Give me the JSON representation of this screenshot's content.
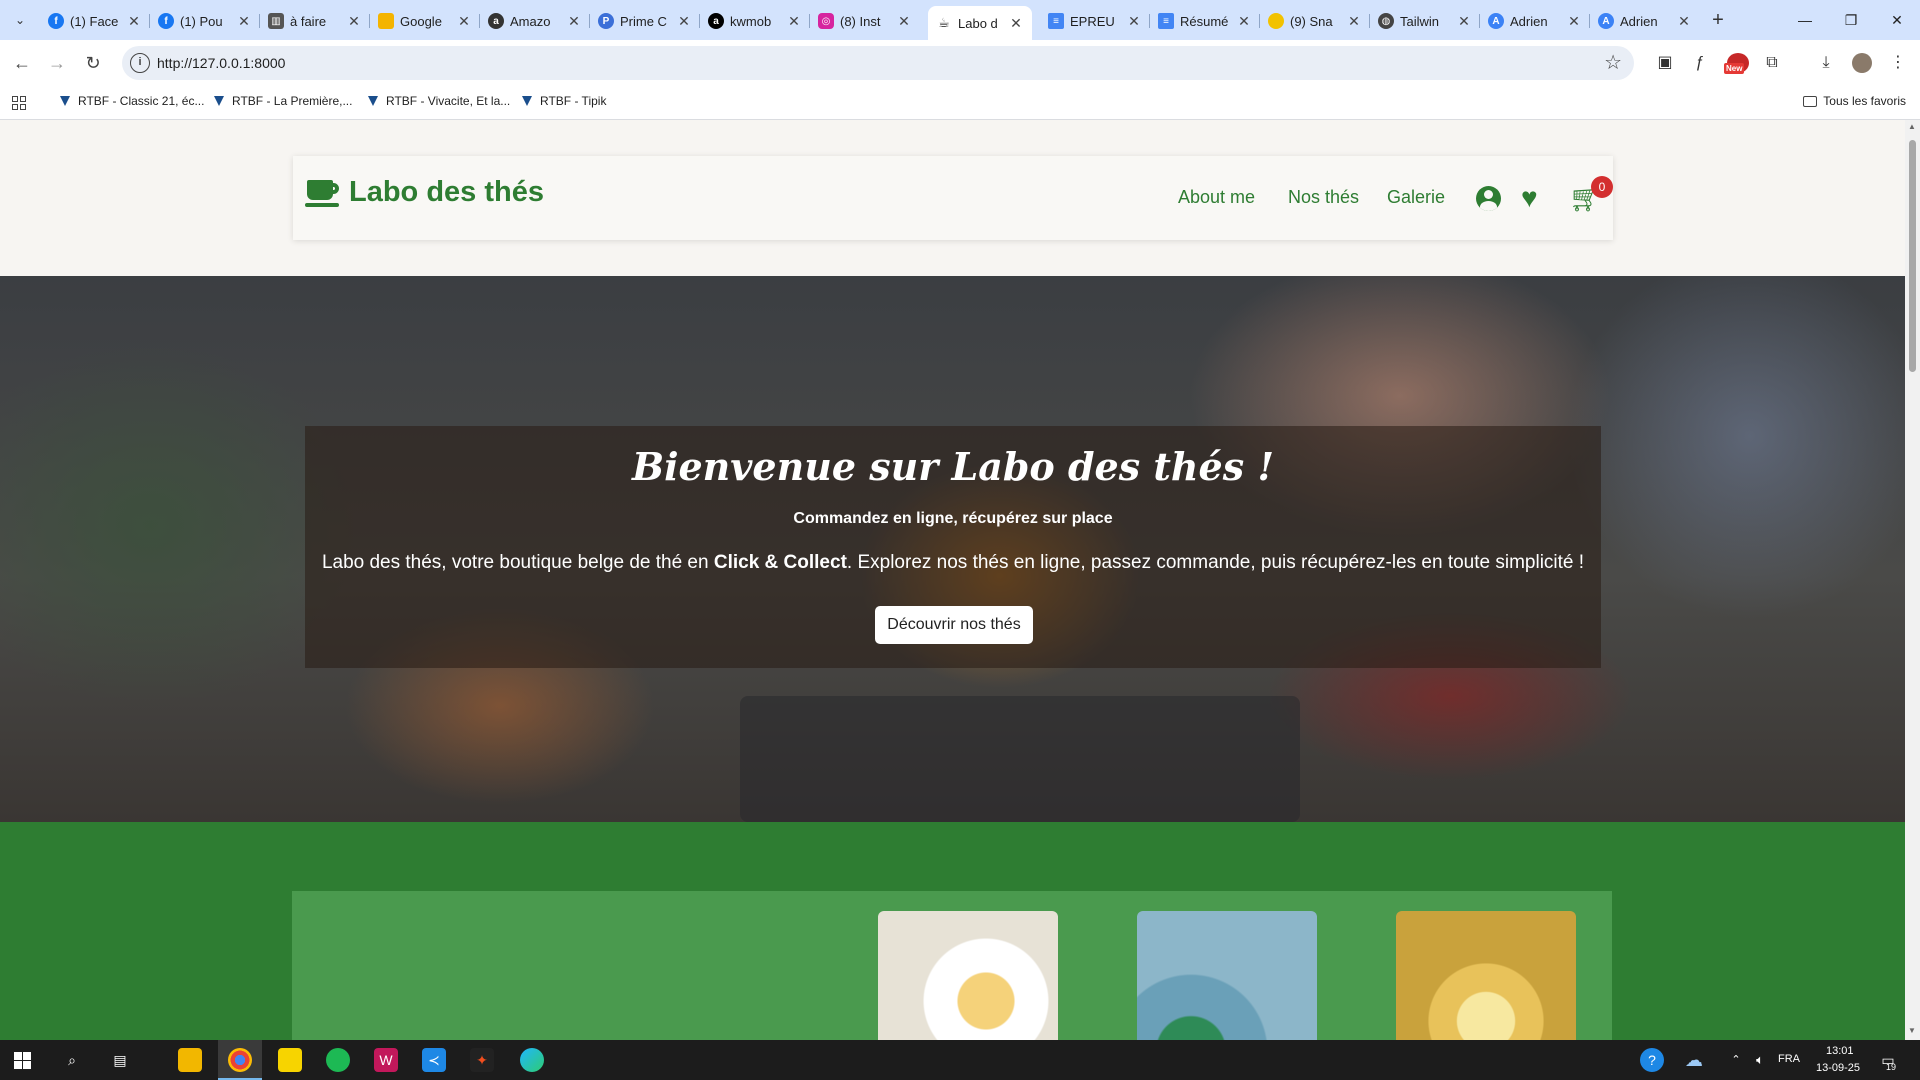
{
  "browser": {
    "tabs": [
      {
        "title": "(1) Face",
        "icon": "facebook-icon",
        "color": "#1877f2"
      },
      {
        "title": "(1) Pou",
        "icon": "facebook-icon",
        "color": "#1877f2"
      },
      {
        "title": "à faire",
        "icon": "trello-icon",
        "color": "#555555"
      },
      {
        "title": "Google",
        "icon": "google-keep-icon",
        "color": "#f4b400"
      },
      {
        "title": "Amazo",
        "icon": "amazon-icon",
        "color": "#333333"
      },
      {
        "title": "Prime C",
        "icon": "prime-icon",
        "color": "#3b6fd8"
      },
      {
        "title": "kwmob",
        "icon": "amazon-icon",
        "color": "#000000"
      },
      {
        "title": "(8) Inst",
        "icon": "instagram-icon",
        "color": "#d6249f"
      },
      {
        "title": "Labo d",
        "icon": "teacup-icon",
        "color": "#222222",
        "active": true
      },
      {
        "title": "EPREU",
        "icon": "docs-icon",
        "color": "#4285f4"
      },
      {
        "title": "Résumé",
        "icon": "docs-icon",
        "color": "#4285f4"
      },
      {
        "title": "(9) Sna",
        "icon": "snapchat-icon",
        "color": "#f2c200"
      },
      {
        "title": "Tailwin",
        "icon": "globe-icon",
        "color": "#444444"
      },
      {
        "title": "Adrien",
        "icon": "profile-icon",
        "color": "#3b82f6"
      },
      {
        "title": "Adrien",
        "icon": "profile-icon",
        "color": "#3b82f6"
      }
    ],
    "url": "http://127.0.0.1:8000",
    "bookmarks": [
      "RTBF - Classic 21, éc...",
      "RTBF - La Première,...",
      "RTBF - Vivacite, Et la...",
      "RTBF - Tipik"
    ],
    "all_favorites": "Tous les favoris",
    "new_badge": "New"
  },
  "site": {
    "brand": "Labo des thés",
    "nav": [
      "About me",
      "Nos thés",
      "Galerie"
    ],
    "cart_count": "0",
    "hero": {
      "title": "Bienvenue sur Labo des thés !",
      "subtitle": "Commandez en ligne, récupérez sur place",
      "text_before": "Labo des thés, votre boutique belge de thé en ",
      "text_bold": "Click & Collect",
      "text_after": ". Explorez nos thés en ligne, passez commande, puis récupérez-les en toute simplicité !",
      "button": "Découvrir nos thés"
    }
  },
  "taskbar": {
    "language": "FRA",
    "time": "13:01",
    "date": "13-09-25",
    "notifications": "19"
  },
  "colors": {
    "brand_green": "#2e7d32",
    "badge_red": "#d32f2f",
    "panel_green": "#4a9a4e"
  }
}
